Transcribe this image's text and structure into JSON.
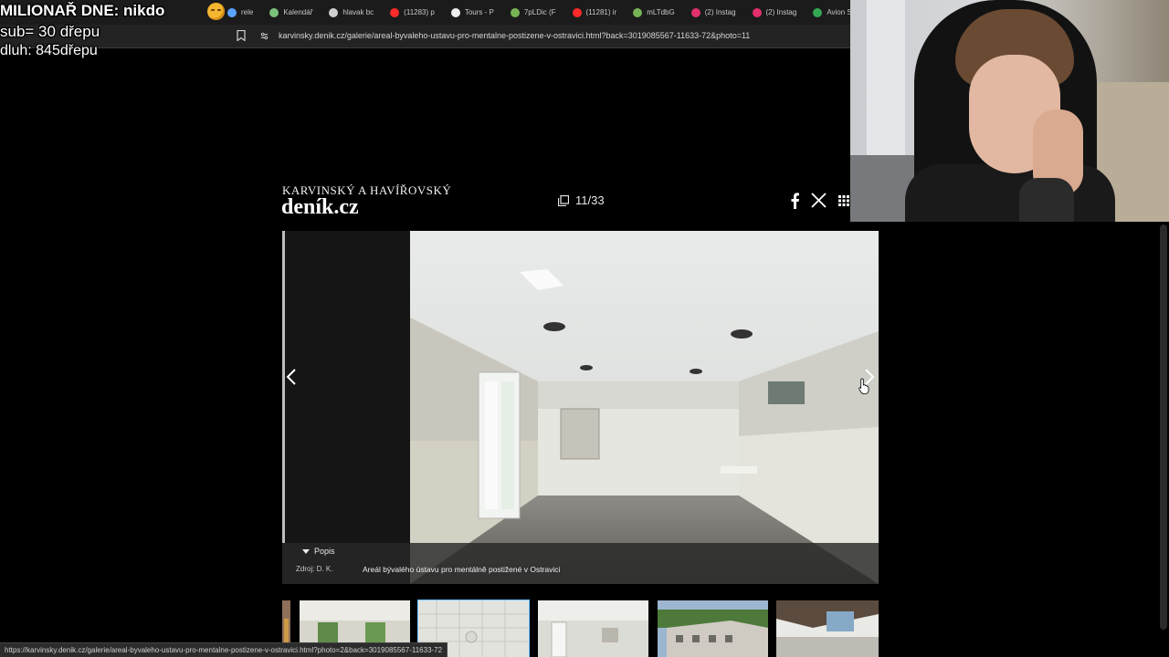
{
  "browser": {
    "tabs": [
      {
        "label": "rele",
        "color": "#5aa2ff"
      },
      {
        "label": "Kalendář",
        "color": "#7ac17a"
      },
      {
        "label": "hlavak bc",
        "color": "#cfcfcf"
      },
      {
        "label": "(11283) p",
        "color": "#ff2a2a"
      },
      {
        "label": "Tours - P",
        "color": "#eeeeee"
      },
      {
        "label": "7pLDic (F",
        "color": "#77b255"
      },
      {
        "label": "(11281) ir",
        "color": "#ff2a2a"
      },
      {
        "label": "mLTdbG",
        "color": "#77b255"
      },
      {
        "label": "(2) Instag",
        "color": "#e1306c"
      },
      {
        "label": "(2) Instag",
        "color": "#e1306c"
      },
      {
        "label": "Avion Sh",
        "color": "#34a853"
      }
    ],
    "url": "karvinsky.denik.cz/galerie/areal-byvaleho-ustavu-pro-mentalne-postizene-v-ostravici.html?back=3019085567-11633-72&photo=11",
    "status_url": "https://karvinsky.denik.cz/galerie/areal-byvaleho-ustavu-pro-mentalne-postizene-v-ostravici.html?photo=2&back=3019085567-11633-72"
  },
  "overlay": {
    "line1": "MILIONAŘ DNE: nikdo",
    "line2": "sub= 30 dřepu",
    "line3": "dluh: 845dřepu"
  },
  "gallery": {
    "brand_sub": "KARVINSKÝ A HAVÍŘOVSKÝ",
    "brand_main": "deník.cz",
    "counter": "11/33",
    "popis_label": "Popis",
    "source": "Zdroj: D. K.",
    "caption": "Areál bývalého ústavu pro mentálně postižené v Ostravici",
    "icons": {
      "counter": "gallery-icon",
      "share1": "facebook-icon",
      "share2": "x-icon",
      "grid": "grid-icon",
      "prev": "chevron-left-icon",
      "next": "chevron-right-icon"
    },
    "accent_selected": "#6ec8ff"
  }
}
